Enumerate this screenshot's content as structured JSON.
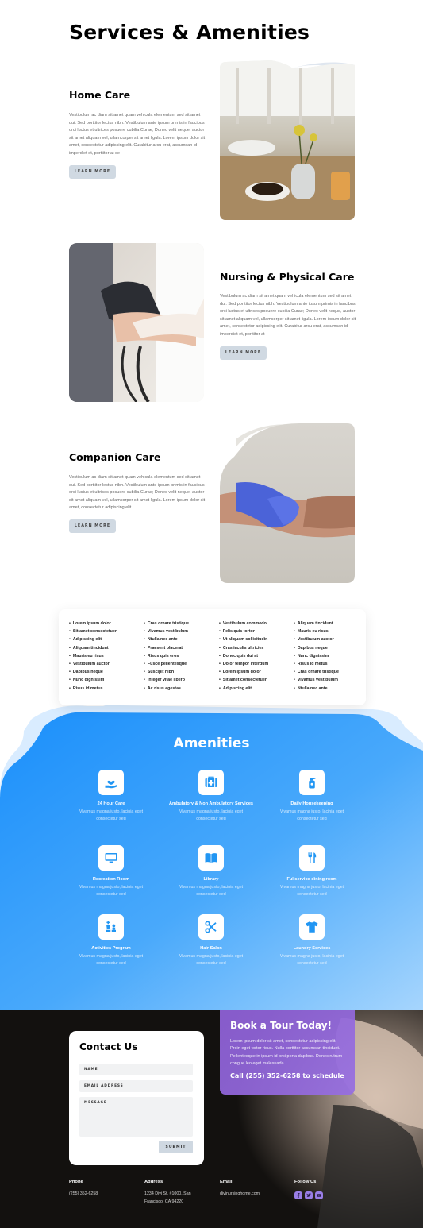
{
  "page": {
    "title": "Services & Amenities"
  },
  "services": [
    {
      "title": "Home Care",
      "body": "Vestibulum ac diam sit amet quam vehicula elementum sed sit amet dui. Sed porttitor lectus nibh. Vestibulum ante ipsum primis in faucibus orci luctus et ultrices posuere cubilia Curae; Donec velit neque, auctor sit amet aliquam vel, ullamcorper sit amet ligula. Lorem ipsum dolor sit amet, consectetur adipiscing elit. Curabitur arcu erat, accumsan id imperdiet et, porttitor at se",
      "button": "LEARN MORE"
    },
    {
      "title": "Nursing & Physical Care",
      "body": "Vestibulum ac diam sit amet quam vehicula elementum sed sit amet dui. Sed porttitor lectus nibh. Vestibulum ante ipsum primis in faucibus orci luctus et ultrices posuere cubilia Curae; Donec velit neque, auctor sit amet aliquam vel, ullamcorper sit amet ligula. Lorem ipsum dolor sit amet, consectetur adipiscing elit. Curabitur arcu erat, accumsan id imperdiet et, porttitor at",
      "button": "LEARN MORE"
    },
    {
      "title": "Companion Care",
      "body": "Vestibulum ac diam sit amet quam vehicula elementum sed sit amet dui. Sed porttitor lectus nibh. Vestibulum ante ipsum primis in faucibus orci luctus et ultrices posuere cubilia Curae; Donec velit neque, auctor sit amet aliquam vel, ullamcorper sit amet ligula. Lorem ipsum dolor sit amet, consectetur adipiscing elit.",
      "button": "LEARN MORE"
    }
  ],
  "feature_list": [
    [
      "Lorem ipsum dolor",
      "Sit amet consectetuer",
      "Adipiscing elit",
      "Aliquam tincidunt",
      "Mauris eu risus",
      "Vestibulum auctor",
      "Dapibus neque",
      "Nunc dignissim",
      "Risus id metus"
    ],
    [
      "Cras ornare tristique",
      "Vivamus vestibulum",
      "Ntulla nec ante",
      "Praesent placerat",
      "Risus quis eros",
      "Fusce pellentesque",
      "Suscipit nibh",
      "Integer vitae libero",
      "Ac risus egestas"
    ],
    [
      "Vestibulum commodo",
      "Felis quis tortor",
      "Ut aliquam sollicitudin",
      "Cras iaculis ultricies",
      "Donec quis dui at",
      "Dolor tempor interdum",
      "Lorem ipsum dolor",
      "Sit amet consectetuer",
      "Adipiscing elit"
    ],
    [
      "Aliquam tincidunt",
      "Mauris eu risus",
      "Vestibulum auctor",
      "Dapibus neque",
      "Nunc dignissim",
      "Risus id metus",
      "Cras ornare tristique",
      "Vivamus vestibulum",
      "Ntulla nec ante"
    ]
  ],
  "amenities": {
    "title": "Amenities",
    "items": [
      {
        "name": "24 Hour Care",
        "desc": "Vivamus magna justo, lacinia eget consectetur sed",
        "icon": "heart-hand-icon"
      },
      {
        "name": "Ambulatory & Non Ambulatory Services",
        "desc": "Vivamus magna justo, lacinia eget consectetur sed",
        "icon": "medical-kit-icon"
      },
      {
        "name": "Daily Housekeeping",
        "desc": "Vivamus magna justo, lacinia eget consectetur sed",
        "icon": "spray-bottle-icon"
      },
      {
        "name": "Recreation Room",
        "desc": "Vivamus magna justo, lacinia eget consectetur sed",
        "icon": "monitor-icon"
      },
      {
        "name": "Library",
        "desc": "Vivamus magna justo, lacinia eget consectetur sed",
        "icon": "book-icon"
      },
      {
        "name": "Fullservice dining room",
        "desc": "Vivamus magna justo, lacinia eget consectetur sed",
        "icon": "utensils-icon"
      },
      {
        "name": "Activities Program",
        "desc": "Vivamus magna justo, lacinia eget consectetur sed",
        "icon": "chess-icon"
      },
      {
        "name": "Hair Salon",
        "desc": "Vivamus magna justo, lacinia eget consectetur sed",
        "icon": "scissors-icon"
      },
      {
        "name": "Laundry Services",
        "desc": "Vivamus magna justo, lacinia eget consectetur sed",
        "icon": "tshirt-icon"
      }
    ]
  },
  "contact": {
    "title": "Contact Us",
    "name_placeholder": "NAME",
    "email_placeholder": "EMAIL ADDRESS",
    "message_placeholder": "MESSAGE",
    "submit": "SUBMIT"
  },
  "tour": {
    "title": "Book a Tour Today!",
    "body": "Lorem ipsum dolor sit amet, consectetur adipiscing elit. Proin eget tortor risus. Nulla porttitor accumsan tincidunt. Pellentesque in ipsum id orci porta dapibus. Donec rutrum congue leo eget malesuada.",
    "call": "Call (255) 352-6258 to schedule"
  },
  "footer": {
    "phone_label": "Phone",
    "phone": "(255) 352-6258",
    "address_label": "Address",
    "address_line1": "1234 Divi St. #1000, San",
    "address_line2": "Francisco, CA 94220",
    "email_label": "Email",
    "email": "divinursinghome.com",
    "follow_label": "Follow Us"
  },
  "colors": {
    "accent_blue": "#2196f3",
    "tour_purple": "#8e60d6",
    "button_gray": "#d0d9e2",
    "footer_dark": "#13110f"
  }
}
